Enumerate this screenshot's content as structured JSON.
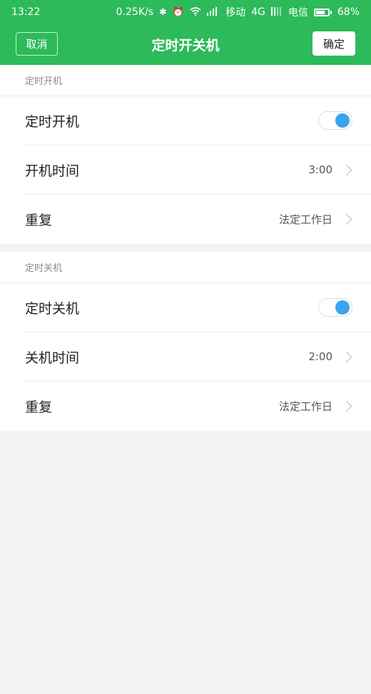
{
  "statusbar": {
    "time": "13:22",
    "speed": "0.25K/s",
    "carrier1": "移动",
    "network": "4G",
    "carrier2": "电信",
    "battery": "68%",
    "battery_level": 0.68
  },
  "header": {
    "cancel_label": "取消",
    "title": "定时开关机",
    "ok_label": "确定",
    "color": "#2dba5a"
  },
  "power_on": {
    "section_title": "定时开机",
    "toggle_label": "定时开机",
    "toggle_on": true,
    "time_label": "开机时间",
    "time_value": "3:00",
    "repeat_label": "重复",
    "repeat_value": "法定工作日"
  },
  "power_off": {
    "section_title": "定时关机",
    "toggle_label": "定时关机",
    "toggle_on": true,
    "time_label": "关机时间",
    "time_value": "2:00",
    "repeat_label": "重复",
    "repeat_value": "法定工作日"
  },
  "colors": {
    "toggle_knob": "#3aa5ec",
    "background": "#f3f3f3"
  }
}
